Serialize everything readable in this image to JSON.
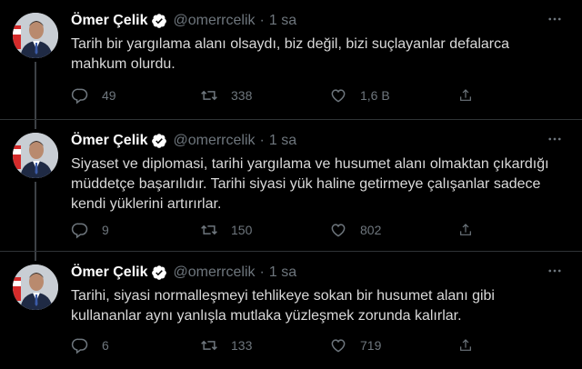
{
  "tweets": [
    {
      "name": "Ömer Çelik",
      "handle": "@omerrcelik",
      "separator": "·",
      "time": "1 sa",
      "text": "Tarih bir yargılama alanı olsaydı, biz değil, bizi suçlayanlar defalarca mahkum olurdu.",
      "replies": "49",
      "retweets": "338",
      "likes": "1,6 B"
    },
    {
      "name": "Ömer Çelik",
      "handle": "@omerrcelik",
      "separator": "·",
      "time": "1 sa",
      "text": "Siyaset ve diplomasi, tarihi yargılama ve husumet alanı olmaktan çıkardığı müddetçe başarılıdır. Tarihi siyasi yük haline getirmeye çalışanlar sadece kendi yüklerini artırırlar.",
      "replies": "9",
      "retweets": "150",
      "likes": "802"
    },
    {
      "name": "Ömer Çelik",
      "handle": "@omerrcelik",
      "separator": "·",
      "time": "1 sa",
      "text": "Tarihi, siyasi normalleşmeyi tehlikeye sokan bir husumet alanı gibi kullananlar aynı yanlışla mutlaka yüzleşmek zorunda kalırlar.",
      "replies": "6",
      "retweets": "133",
      "likes": "719"
    }
  ],
  "icons": {
    "verified": "verified-badge-icon",
    "more": "more-options-icon",
    "reply": "reply-icon",
    "retweet": "retweet-icon",
    "like": "like-icon",
    "share": "share-icon"
  },
  "colors": {
    "background": "#000000",
    "text": "#d9d9d9",
    "name": "#ffffff",
    "muted": "#6e767d",
    "divider": "#2f3336"
  }
}
